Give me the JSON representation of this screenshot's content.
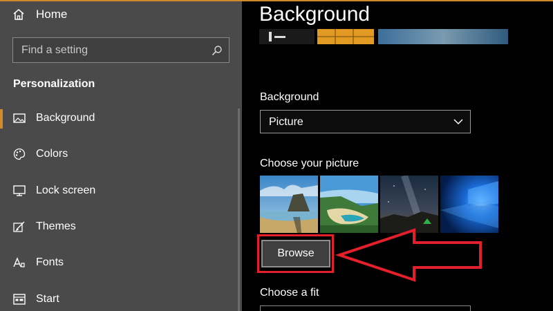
{
  "sidebar": {
    "home_label": "Home",
    "search_placeholder": "Find a setting",
    "section_title": "Personalization",
    "items": [
      {
        "label": "Background",
        "icon": "picture-icon",
        "selected": true
      },
      {
        "label": "Colors",
        "icon": "palette-icon",
        "selected": false
      },
      {
        "label": "Lock screen",
        "icon": "monitor-icon",
        "selected": false
      },
      {
        "label": "Themes",
        "icon": "brush-icon",
        "selected": false
      },
      {
        "label": "Fonts",
        "icon": "font-icon",
        "selected": false
      },
      {
        "label": "Start",
        "icon": "start-icon",
        "selected": false
      }
    ]
  },
  "main": {
    "title": "Background",
    "background_label": "Background",
    "background_value": "Picture",
    "choose_picture_label": "Choose your picture",
    "thumbnails": [
      "beach-rock-thumbnail",
      "coast-cliff-thumbnail",
      "night-sky-tent-thumbnail",
      "windows-light-thumbnail"
    ],
    "browse_label": "Browse",
    "choose_fit_label": "Choose a fit"
  },
  "colors": {
    "accent": "#d08a2c",
    "sidebar_bg": "#4a4a4a",
    "content_bg": "#000000",
    "highlight": "#e21f2a"
  }
}
